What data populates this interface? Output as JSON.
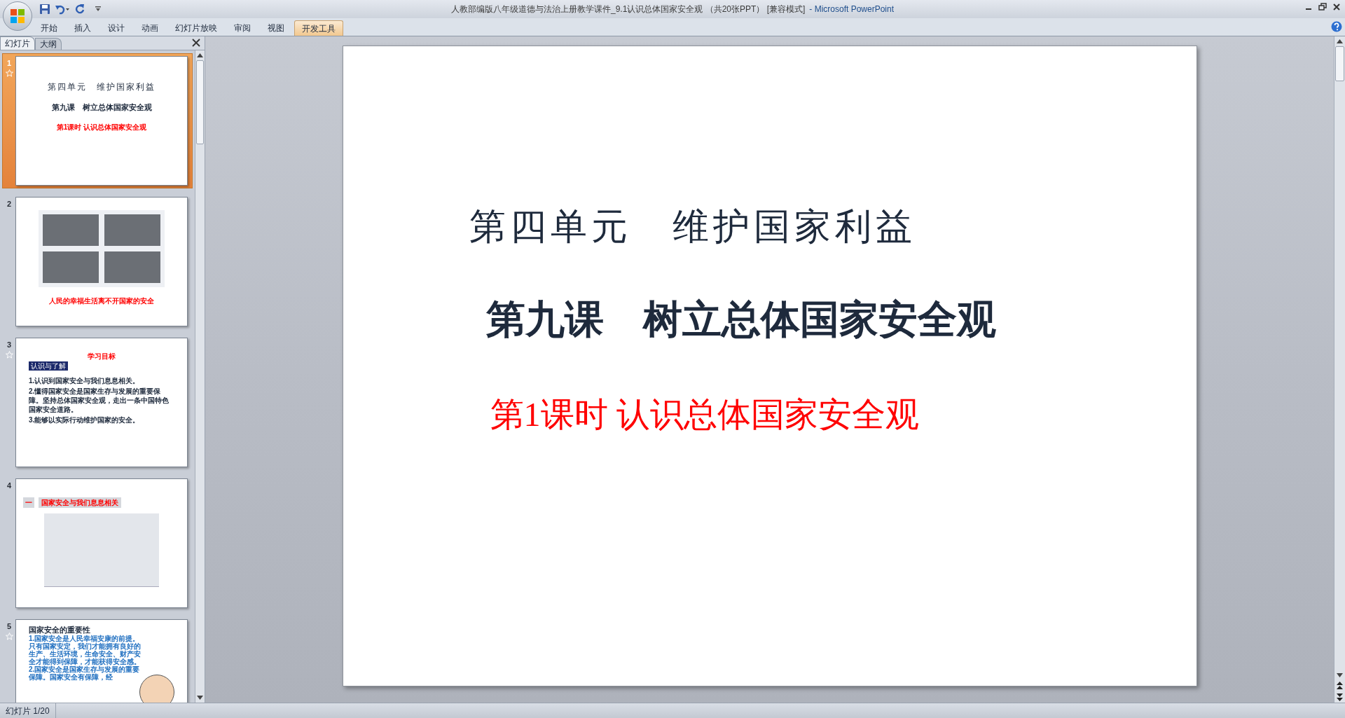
{
  "window": {
    "title": "人教部编版八年级道德与法治上册教学课件_9.1认识总体国家安全观 （共20张PPT） [兼容模式]",
    "app": "- Microsoft PowerPoint"
  },
  "ribbon_tabs": [
    {
      "label": "开始",
      "selected": false
    },
    {
      "label": "插入",
      "selected": false
    },
    {
      "label": "设计",
      "selected": false
    },
    {
      "label": "动画",
      "selected": false
    },
    {
      "label": "幻灯片放映",
      "selected": false
    },
    {
      "label": "审阅",
      "selected": false
    },
    {
      "label": "视图",
      "selected": false
    },
    {
      "label": "开发工具",
      "selected": true
    }
  ],
  "pane_tabs": [
    {
      "label": "幻灯片",
      "selected": true
    },
    {
      "label": "大纲",
      "selected": false
    }
  ],
  "slides": [
    {
      "number": "1",
      "animated": true,
      "selected": true,
      "kind": "title",
      "lines": [
        "第四单元　维护国家利益",
        "第九课　树立总体国家安全观",
        "第1课时 认识总体国家安全观"
      ]
    },
    {
      "number": "2",
      "animated": false,
      "selected": false,
      "kind": "photos",
      "caption": "人民的幸福生活离不开国家的安全"
    },
    {
      "number": "3",
      "animated": true,
      "selected": false,
      "kind": "objectives",
      "heading": "学习目标",
      "badge": "认识与了解",
      "items": [
        "1.认识到国家安全与我们息息相关。",
        "2.懂得国家安全是国家生存与发展的重要保障。坚持总体国家安全观，走出一条中国特色国家安全道路。",
        "3.能够以实际行动维护国家的安全。"
      ]
    },
    {
      "number": "4",
      "animated": false,
      "selected": false,
      "kind": "article",
      "marker": "一",
      "heading": "国家安全与我们息息相关"
    },
    {
      "number": "5",
      "animated": true,
      "selected": false,
      "kind": "text",
      "heading": "国家安全的重要性",
      "body": "1.国家安全是人民幸福安康的前提。只有国家安定，我们才能拥有良好的生产、生活环境，生命安全、财产安全才能得到保障，才能获得安全感。2.国家安全是国家生存与发展的重要保障。国家安全有保障，经"
    }
  ],
  "current_slide": {
    "unit_title": "第四单元　维护国家利益",
    "lesson_title": "第九课　树立总体国家安全观",
    "period_title": "第1课时 认识总体国家安全观"
  },
  "status_bar": {
    "text": "幻灯片 1/20"
  }
}
